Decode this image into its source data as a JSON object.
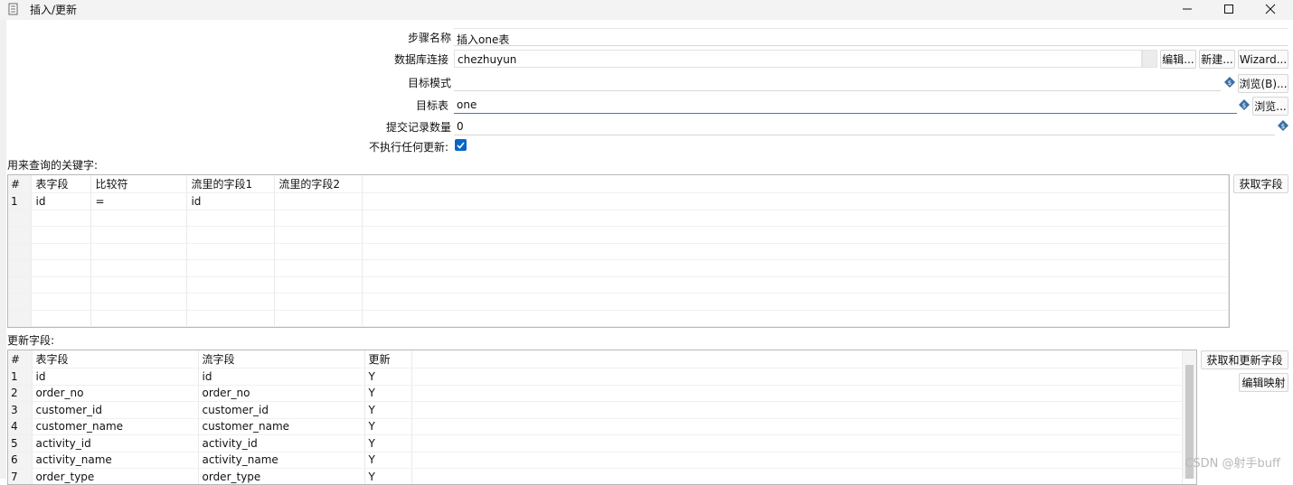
{
  "window": {
    "title": "插入/更新",
    "controls": [
      "minimize-icon",
      "maximize-icon",
      "close-icon"
    ]
  },
  "form": {
    "step_name_label": "步骤名称",
    "step_name_value": "插入one表",
    "connection_label": "数据库连接",
    "connection_value": "chezhuyun",
    "edit_button": "编辑...",
    "new_button": "新建...",
    "wizard_button": "Wizard...",
    "schema_label": "目标模式",
    "schema_value": "",
    "schema_browse_button": "浏览(B)...",
    "table_label": "目标表",
    "table_value": "one",
    "table_browse_button": "浏览...",
    "commit_label": "提交记录数量",
    "commit_value": "0",
    "no_update_label": "不执行任何更新:",
    "no_update_checked": true,
    "variable_icon": "variable-diamond-icon"
  },
  "keys": {
    "section_label": "用来查询的关键字:",
    "get_fields_button": "获取字段",
    "columns": [
      "#",
      "表字段",
      "比较符",
      "流里的字段1",
      "流里的字段2"
    ],
    "rows": [
      [
        "1",
        "id",
        "=",
        "id",
        ""
      ]
    ]
  },
  "updates": {
    "section_label": "更新字段:",
    "get_update_fields_button": "获取和更新字段",
    "edit_mapping_button": "编辑映射",
    "columns": [
      "#",
      "表字段",
      "流字段",
      "更新"
    ],
    "rows": [
      [
        "1",
        "id",
        "id",
        "Y"
      ],
      [
        "2",
        "order_no",
        "order_no",
        "Y"
      ],
      [
        "3",
        "customer_id",
        "customer_id",
        "Y"
      ],
      [
        "4",
        "customer_name",
        "customer_name",
        "Y"
      ],
      [
        "5",
        "activity_id",
        "activity_id",
        "Y"
      ],
      [
        "6",
        "activity_name",
        "activity_name",
        "Y"
      ],
      [
        "7",
        "order_type",
        "order_type",
        "Y"
      ]
    ]
  },
  "watermark": "CSDN @射手buff",
  "colors": {
    "accent": "#0a64c8",
    "variable_icon": "#3a6ea5",
    "focus_underline": "#3c78c8"
  }
}
